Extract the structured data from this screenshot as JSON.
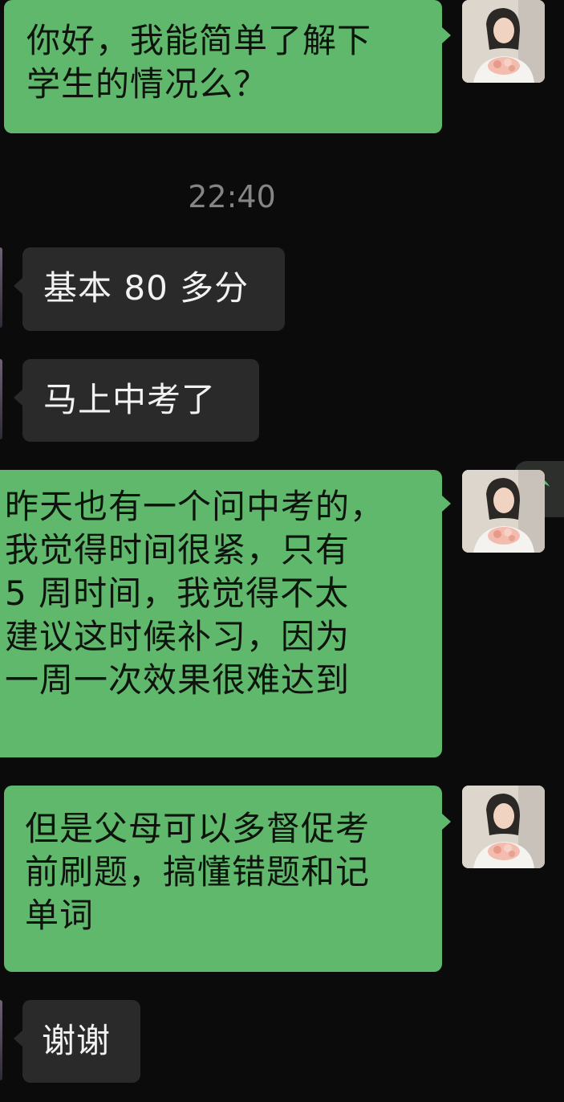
{
  "timestamp": "22:40",
  "messages": [
    {
      "side": "out",
      "text": "你好，我能简单了解下\n学生的情况么？"
    },
    {
      "side": "in",
      "text": "基本 80 多分"
    },
    {
      "side": "in",
      "text": "马上中考了"
    },
    {
      "side": "out",
      "text": "昨天也有一个问中考的，\n我觉得时间很紧，只有\n5 周时间，我觉得不太\n建议这时候补习，因为\n一周一次效果很难达到"
    },
    {
      "side": "out",
      "text": "但是父母可以多督促考\n前刷题，搞懂错题和记\n单词"
    },
    {
      "side": "in",
      "text": "谢谢"
    }
  ],
  "icons": {
    "avatar": "woman-holding-flowers-avatar",
    "music": "music-note-icon"
  },
  "colors": {
    "background": "#0b0b0b",
    "outgoing_bubble": "#5fb86b",
    "incoming_bubble": "#2a2a2a",
    "timestamp": "#858585",
    "music_note": "#4cc86a"
  }
}
